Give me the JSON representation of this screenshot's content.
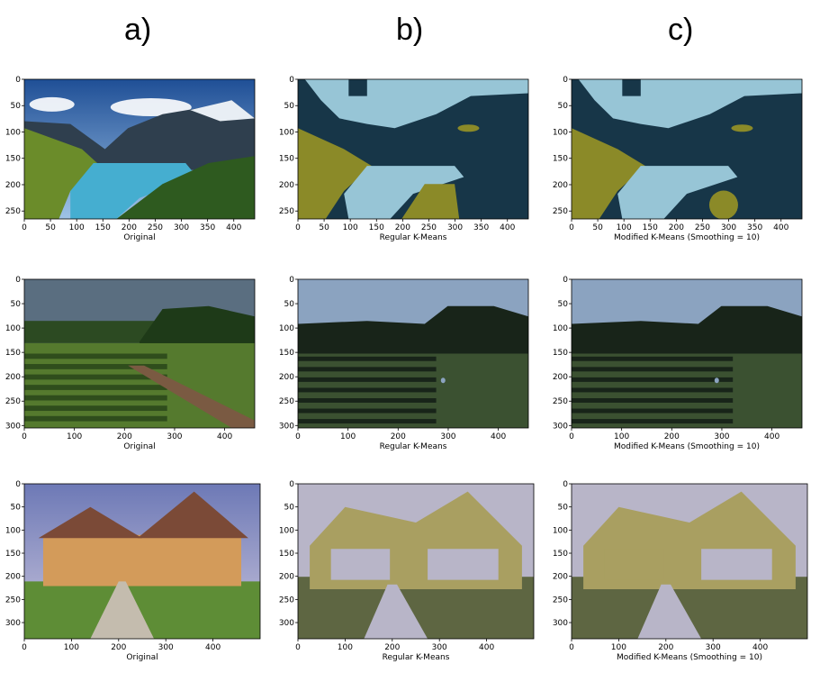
{
  "columns": [
    "a)",
    "b)",
    "c)"
  ],
  "rows": [
    {
      "xticks": [
        "0",
        "50",
        "100",
        "150",
        "200",
        "250",
        "300",
        "350",
        "400"
      ],
      "yticks": [
        "0",
        "50",
        "100",
        "150",
        "200",
        "250"
      ],
      "panels": [
        {
          "caption": "Original",
          "kind": "original",
          "scene": "lake"
        },
        {
          "caption": "Regular K-Means",
          "kind": "regular",
          "scene": "lake"
        },
        {
          "caption": "Modified K-Means (Smoothing = 10)",
          "kind": "modified",
          "scene": "lake"
        }
      ]
    },
    {
      "xticks": [
        "0",
        "100",
        "200",
        "300",
        "400"
      ],
      "yticks": [
        "0",
        "50",
        "100",
        "150",
        "200",
        "250",
        "300"
      ],
      "panels": [
        {
          "caption": "Original",
          "kind": "original",
          "scene": "field"
        },
        {
          "caption": "Regular K-Means",
          "kind": "regular",
          "scene": "field"
        },
        {
          "caption": "Modified K-Means (Smoothing = 10)",
          "kind": "modified",
          "scene": "field"
        }
      ]
    },
    {
      "xticks": [
        "0",
        "100",
        "200",
        "300",
        "400"
      ],
      "yticks": [
        "0",
        "50",
        "100",
        "150",
        "200",
        "250",
        "300"
      ],
      "panels": [
        {
          "caption": "Original",
          "kind": "original",
          "scene": "house"
        },
        {
          "caption": "Regular K-Means",
          "kind": "regular",
          "scene": "house"
        },
        {
          "caption": "Modified K-Means (Smoothing = 10)",
          "kind": "modified",
          "scene": "house"
        }
      ]
    }
  ],
  "palettes": {
    "lake": {
      "a": "#173648",
      "b": "#97c5d6",
      "c": "#8b8a28"
    },
    "field": {
      "a": "#8ba3c0",
      "b": "#182419",
      "c": "#3b5131"
    },
    "house": {
      "a": "#b8b5c8",
      "b": "#a99f61",
      "c": "#5e6642"
    }
  }
}
